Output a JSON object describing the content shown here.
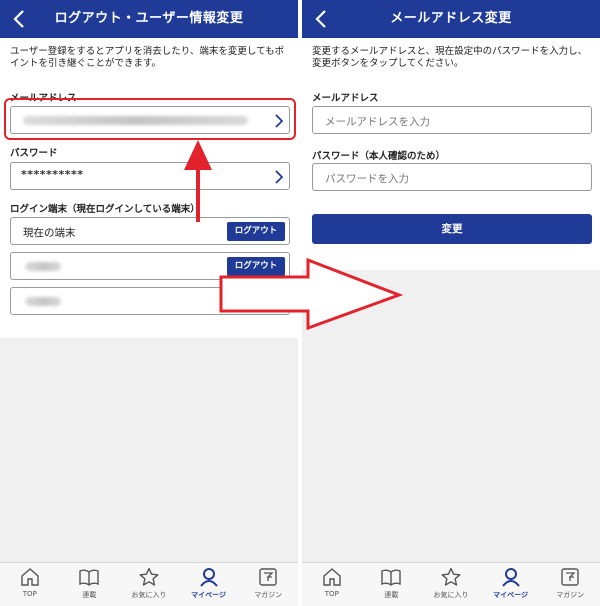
{
  "colors": {
    "brand": "#1f3b97",
    "annotation": "#e3232b"
  },
  "left": {
    "title": "ログアウト・ユーザー情報変更",
    "description": "ユーザー登録をするとアプリを消去したり、端末を変更してもポイントを引き継ぐことができます。",
    "email_label": "メールアドレス",
    "password_label": "パスワード",
    "password_value": "**********",
    "devices_label": "ログイン端末（現在ログインしている端末）",
    "devices": [
      {
        "name": "現在の端末",
        "button": "ログアウト"
      },
      {
        "name": "",
        "button": "ログアウト"
      },
      {
        "name": "",
        "button": ""
      }
    ]
  },
  "right": {
    "title": "メールアドレス変更",
    "description": "変更するメールアドレスと、現在設定中のパスワードを入力し、変更ボタンをタップしてください。",
    "email_label": "メールアドレス",
    "email_placeholder": "メールアドレスを入力",
    "password_label": "パスワード（本人確認のため）",
    "password_placeholder": "パスワードを入力",
    "submit": "変更"
  },
  "tabs": [
    {
      "label": "TOP",
      "icon": "home-icon",
      "active": false
    },
    {
      "label": "連載",
      "icon": "book-icon",
      "active": false
    },
    {
      "label": "お気に入り",
      "icon": "star-icon",
      "active": false
    },
    {
      "label": "マイページ",
      "icon": "person-icon",
      "active": true
    },
    {
      "label": "マガジン",
      "icon": "magazine-icon",
      "active": false
    }
  ]
}
